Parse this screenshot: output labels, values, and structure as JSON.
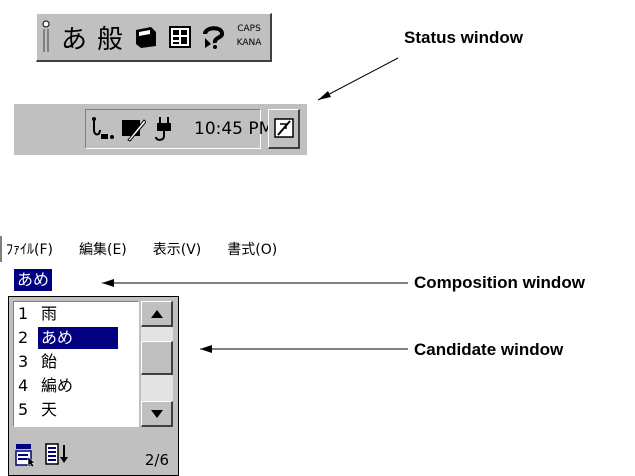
{
  "status_window": {
    "icons": [
      "ime-pen-grip-icon",
      "hiragana-mode-icon",
      "conversion-mode-icon",
      "dictionary-icon",
      "pad-icon",
      "help-icon"
    ],
    "mode_char": "あ",
    "conversion_char": "般",
    "caps_label": "CAPS",
    "kana_label": "KANA"
  },
  "taskbar": {
    "clock": "10:45 PM",
    "tray_icons": [
      "network-icon",
      "pen-icon",
      "power-plug-icon"
    ],
    "tray_button_icon": "ime-toggle-icon"
  },
  "labels": {
    "status": "Status window",
    "composition": "Composition window",
    "candidate": "Candidate window"
  },
  "menu": {
    "items": [
      "ﾌｧｲﾙ(F)",
      "編集(E)",
      "表示(V)",
      "書式(O)"
    ]
  },
  "composition": {
    "text": "あめ"
  },
  "candidate": {
    "items": [
      {
        "num": "1",
        "text": "雨"
      },
      {
        "num": "2",
        "text": "あめ"
      },
      {
        "num": "3",
        "text": "飴"
      },
      {
        "num": "4",
        "text": "編め"
      },
      {
        "num": "5",
        "text": "天"
      }
    ],
    "selected": 2,
    "page": "2/6"
  },
  "colors": {
    "selection": "#000080",
    "face": "#c0c0c0"
  }
}
